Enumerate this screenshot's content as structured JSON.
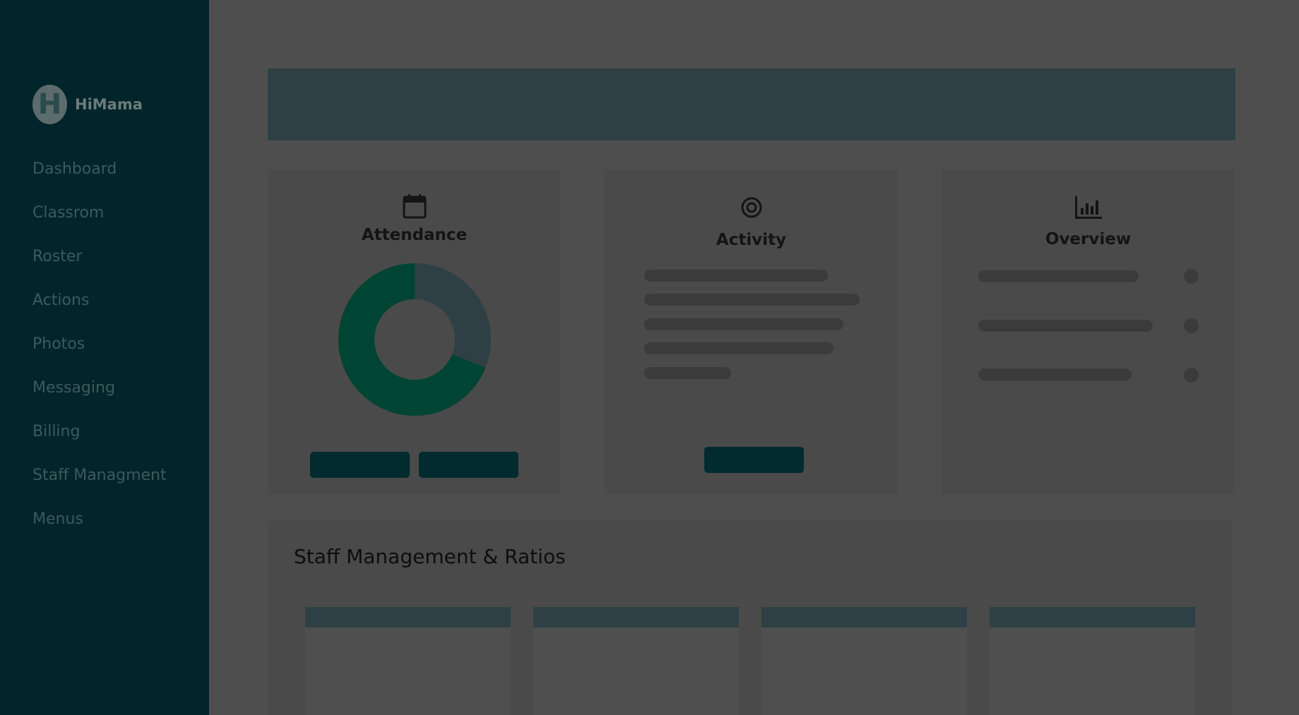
{
  "sidebar": {
    "brand": {
      "initial": "H",
      "name": "HiMama"
    },
    "items": [
      {
        "label": "Dashboard"
      },
      {
        "label": "Classrom"
      },
      {
        "label": "Roster"
      },
      {
        "label": "Actions"
      },
      {
        "label": "Photos"
      },
      {
        "label": "Messaging"
      },
      {
        "label": "Billing"
      },
      {
        "label": "Staff Managment"
      },
      {
        "label": "Menus"
      }
    ]
  },
  "cards": {
    "attendance": {
      "title": "Attendance",
      "icon": "calendar-icon",
      "donut_fraction_primary": 0.69
    },
    "activity": {
      "title": "Activity",
      "icon": "target-icon"
    },
    "overview": {
      "title": "Overview",
      "icon": "bar-chart-icon"
    }
  },
  "staff_section": {
    "title": "Staff Management & Ratios"
  },
  "colors": {
    "sidebar_bg": "#01252a",
    "accent_dark": "#012b2f",
    "donut_primary": "#004433",
    "donut_secondary": "#2e4045",
    "overlay_bg": "#4e4e4e"
  }
}
